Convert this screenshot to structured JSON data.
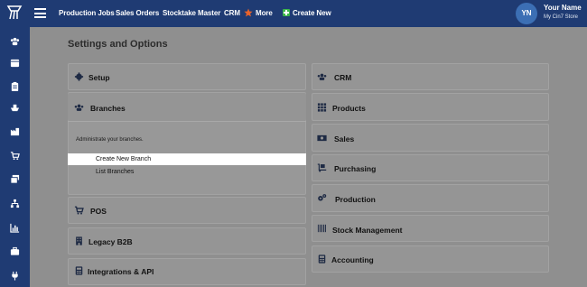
{
  "topbar": {
    "nav": [
      "Production Jobs",
      "Sales Orders",
      "Stocktake Master",
      "CRM",
      "More",
      "Create New"
    ],
    "user": {
      "initials": "YN",
      "name": "Your Name",
      "store": "My Cin7 Store"
    }
  },
  "sidebar": {
    "icons": [
      "users-icon",
      "calendar-icon",
      "clipboard-icon",
      "ship-icon",
      "factory-icon",
      "cart-icon",
      "layers-icon",
      "sitemap-icon",
      "bar-chart-icon",
      "briefcase-icon",
      "plug-icon"
    ]
  },
  "page": {
    "title": "Settings and Options"
  },
  "left_cards": {
    "setup": "Setup",
    "branches": "Branches",
    "branches_desc": "Administrate your branches.",
    "create_branch": "Create New Branch",
    "list_branches": "List Branches",
    "pos": "POS",
    "legacy_b2b": "Legacy B2B",
    "integrations": "Integrations & API"
  },
  "right_cards": {
    "crm": "CRM",
    "products": "Products",
    "sales": "Sales",
    "purchasing": "Purchasing",
    "production": "Production",
    "stock": "Stock Management",
    "accounting": "Accounting"
  },
  "colors": {
    "topbar": "#1f3b73",
    "avatar": "#3c6fb4",
    "accent_green": "#3bb54a",
    "accent_orange": "#e8632b"
  }
}
